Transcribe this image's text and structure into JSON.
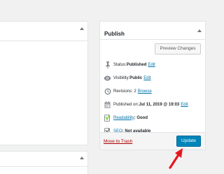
{
  "publish": {
    "title": "Publish",
    "preview_label": "Preview Changes",
    "status": {
      "label": "Status: ",
      "value": "Published",
      "edit": "Edit"
    },
    "visibility": {
      "label": "Visibility: ",
      "value": "Public",
      "edit": "Edit"
    },
    "revisions": {
      "label": "Revisions: 2",
      "link": "Browse"
    },
    "published_on": {
      "label": "Published on: ",
      "value": "Jul 11, 2019 @ 19:03",
      "edit": "Edit"
    },
    "readability": {
      "link": "Readability",
      "value": ": Good"
    },
    "seo": {
      "link": "SEO",
      "value": ": Not available"
    },
    "trash_label": "Move to Trash",
    "update_label": "Update"
  },
  "colors": {
    "accent": "#0085ba",
    "link": "#0073aa",
    "trash": "#aa0000",
    "annotation_arrow": "#e8161b",
    "readability_good": "#7ad03a"
  },
  "icons": {
    "status": "pin-icon",
    "visibility": "eye-icon",
    "revisions": "history-icon",
    "published_on": "calendar-icon",
    "readability": "yoast-traffic-light-icon",
    "seo": "yoast-icon",
    "arrow": "red-annotation-arrow"
  }
}
